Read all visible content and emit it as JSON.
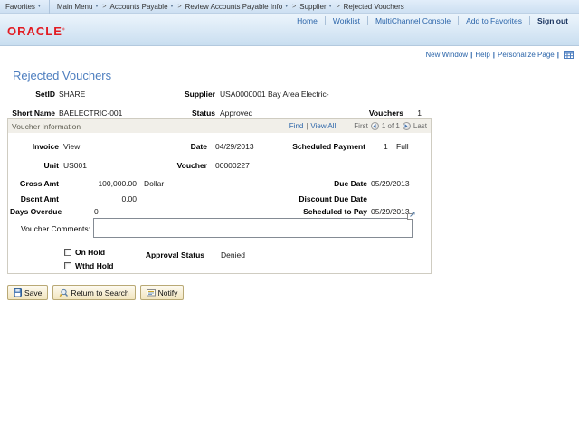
{
  "breadcrumb": {
    "favorites": "Favorites",
    "main_menu": "Main Menu",
    "crumbs": [
      "Accounts Payable",
      "Review Accounts Payable Info",
      "Supplier",
      "Rejected Vouchers"
    ]
  },
  "header": {
    "logo": "ORACLE",
    "links": [
      "Home",
      "Worklist",
      "MultiChannel Console",
      "Add to Favorites"
    ],
    "signout": "Sign out"
  },
  "utility": {
    "new_window": "New Window",
    "help": "Help",
    "personalize": "Personalize Page"
  },
  "page": {
    "title": "Rejected Vouchers"
  },
  "summary": {
    "setid_label": "SetID",
    "setid": "SHARE",
    "supplier_label": "Supplier",
    "supplier_id": "USA0000001",
    "supplier_name": "Bay Area Electric-",
    "short_name_label": "Short Name",
    "short_name": "BAELECTRIC-001",
    "status_label": "Status",
    "status": "Approved",
    "vouchers_label": "Vouchers",
    "vouchers": "1"
  },
  "voucher_box": {
    "title": "Voucher Information",
    "find": "Find",
    "view_all": "View All",
    "first": "First",
    "page_info": "1 of 1",
    "last": "Last",
    "invoice_label": "Invoice",
    "invoice": "View",
    "date_label": "Date",
    "date": "04/29/2013",
    "sched_payment_label": "Scheduled Payment",
    "sched_payment": "1",
    "sched_payment_type": "Full",
    "unit_label": "Unit",
    "unit": "US001",
    "voucher_label": "Voucher",
    "voucher": "00000227",
    "gross_label": "Gross Amt",
    "gross": "100,000.00",
    "currency": "Dollar",
    "due_label": "Due Date",
    "due": "05/29/2013",
    "dscnt_label": "Dscnt Amt",
    "dscnt": "0.00",
    "discount_due_label": "Discount Due Date",
    "discount_due": "",
    "days_overdue_label": "Days Overdue",
    "days_overdue": "0",
    "sched_pay_label": "Scheduled to Pay",
    "sched_pay": "05/29/2013",
    "comments_label": "Voucher Comments:",
    "comments": "",
    "on_hold_label": "On Hold",
    "wthd_hold_label": "Wthd Hold",
    "approval_label": "Approval Status",
    "approval": "Denied"
  },
  "toolbar": {
    "save": "Save",
    "return_to_search": "Return to Search",
    "notify": "Notify"
  },
  "colors": {
    "link_blue": "#2a64a9",
    "title_blue": "#4d7ebf",
    "oracle_red": "#e21b22",
    "button_face": "#f2e5bf"
  }
}
